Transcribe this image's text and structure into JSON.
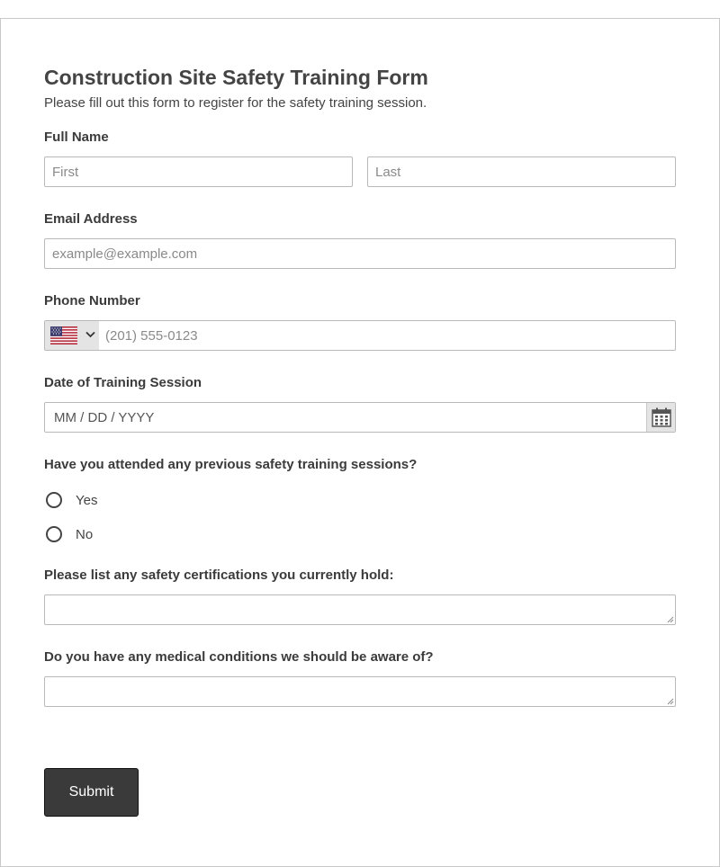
{
  "form": {
    "title": "Construction Site Safety Training Form",
    "subtitle": "Please fill out this form to register for the safety training session."
  },
  "full_name": {
    "label": "Full Name",
    "first_placeholder": "First",
    "last_placeholder": "Last"
  },
  "email": {
    "label": "Email Address",
    "placeholder": "example@example.com"
  },
  "phone": {
    "label": "Phone Number",
    "country_icon": "us-flag-icon",
    "placeholder": "(201) 555-0123"
  },
  "date": {
    "label": "Date of Training Session",
    "placeholder": "MM / DD / YYYY",
    "icon": "calendar-icon"
  },
  "previous_training": {
    "question": "Have you attended any previous safety training sessions?",
    "options": [
      "Yes",
      "No"
    ]
  },
  "certifications": {
    "label": "Please list any safety certifications you currently hold:",
    "value": ""
  },
  "medical": {
    "label": "Do you have any medical conditions we should be aware of?",
    "value": ""
  },
  "submit_label": "Submit",
  "colors": {
    "text": "#444444",
    "border": "#b9b9b9",
    "button_bg": "#3a3a3a",
    "button_text": "#ffffff",
    "addon_bg": "#e4e4e4"
  }
}
